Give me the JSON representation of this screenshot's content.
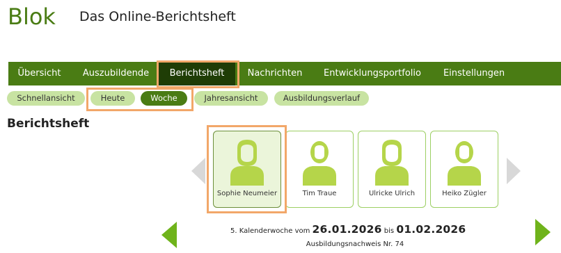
{
  "app": {
    "logo_text": "Blok",
    "title": "Das Online-Berichtsheft"
  },
  "colors": {
    "brand_green": "#4a7c14",
    "active_nav": "#1f3d06",
    "pill_green": "#c8e3a2",
    "avatar_green": "#b5d54a",
    "highlight_orange": "#f2a769"
  },
  "main_nav": {
    "items": [
      {
        "label": "Übersicht"
      },
      {
        "label": "Auszubildende"
      },
      {
        "label": "Berichtsheft",
        "active": true
      },
      {
        "label": "Nachrichten"
      },
      {
        "label": "Entwicklungsportfolio"
      },
      {
        "label": "Einstellungen"
      }
    ]
  },
  "sub_nav": {
    "items": [
      {
        "label": "Schnellansicht"
      },
      {
        "label": "Heute"
      },
      {
        "label": "Woche",
        "active": true
      },
      {
        "label": "Jahresansicht"
      },
      {
        "label": "Ausbildungsverlauf"
      }
    ]
  },
  "section": {
    "title": "Berichtsheft"
  },
  "trainees": [
    {
      "name": "Sophie Neumeier",
      "gender": "female",
      "selected": true
    },
    {
      "name": "Tim Traue",
      "gender": "male"
    },
    {
      "name": "Ulricke Ulrich",
      "gender": "female"
    },
    {
      "name": "Heiko Zügler",
      "gender": "male"
    }
  ],
  "icons": {
    "prev_trainees": "chevron-left-icon",
    "next_trainees": "chevron-right-icon",
    "prev_week": "arrow-left-icon",
    "next_week": "arrow-right-icon",
    "avatar": "person-avatar-icon"
  },
  "week": {
    "prefix": "5. Kalenderwoche vom",
    "start_date": "26.01.2026",
    "between": "bis",
    "end_date": "01.02.2026",
    "report_number": "Ausbildungsnachweis Nr. 74"
  }
}
